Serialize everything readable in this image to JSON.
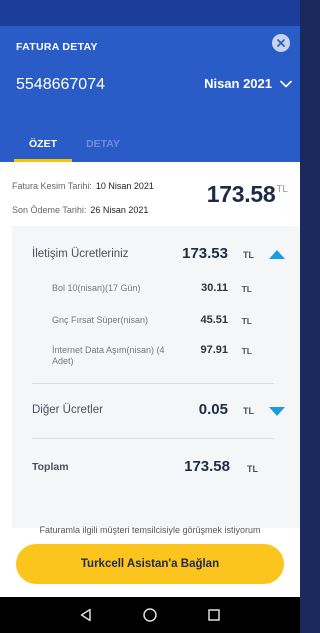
{
  "header": {
    "title": "FATURA DETAY",
    "phone_number": "5548667074",
    "period": "Nisan 2021",
    "tabs": [
      {
        "label": "ÖZET",
        "active": true
      },
      {
        "label": "DETAY",
        "active": false
      }
    ]
  },
  "summary": {
    "cut_date_label": "Fatura Kesim Tarihi:",
    "cut_date_value": "10 Nisan 2021",
    "due_date_label": "Son Ödeme Tarihi:",
    "due_date_value": "26 Nisan 2021",
    "total_amount": "173.58",
    "total_currency": "TL"
  },
  "charges": {
    "communication": {
      "label": "İletişim Ücretleriniz",
      "amount": "173.53",
      "currency": "TL",
      "expanded": true,
      "items": [
        {
          "label": "Bol 10(nisan)(17 Gün)",
          "amount": "30.11",
          "currency": "TL"
        },
        {
          "label": "Gnç Fırsat Süper(nisan)",
          "amount": "45.51",
          "currency": "TL"
        },
        {
          "label": "İnternet Data Aşım(nisan) (4 Adet)",
          "amount": "97.91",
          "currency": "TL"
        }
      ]
    },
    "other": {
      "label": "Diğer Ücretler",
      "amount": "0.05",
      "currency": "TL",
      "expanded": false
    },
    "total": {
      "label": "Toplam",
      "amount": "173.58",
      "currency": "TL"
    }
  },
  "footer": {
    "prompt_text": "Faturamla ilgili müşteri temsilcisiyle görüşmek istiyorum",
    "cta_label": "Turkcell Asistan'a Bağlan"
  },
  "icons": {
    "close": "close-icon",
    "period_dropdown": "chevron-down-icon",
    "collapse": "triangle-up-icon",
    "expand": "triangle-down-icon",
    "nav_back": "back-triangle-icon",
    "nav_home": "home-circle-icon",
    "nav_recents": "recents-square-icon"
  },
  "colors": {
    "header_blue": "#2a5cc7",
    "accent_yellow": "#fcc51e",
    "toggle_blue": "#1e9be0",
    "text_dark": "#1d2b45"
  }
}
